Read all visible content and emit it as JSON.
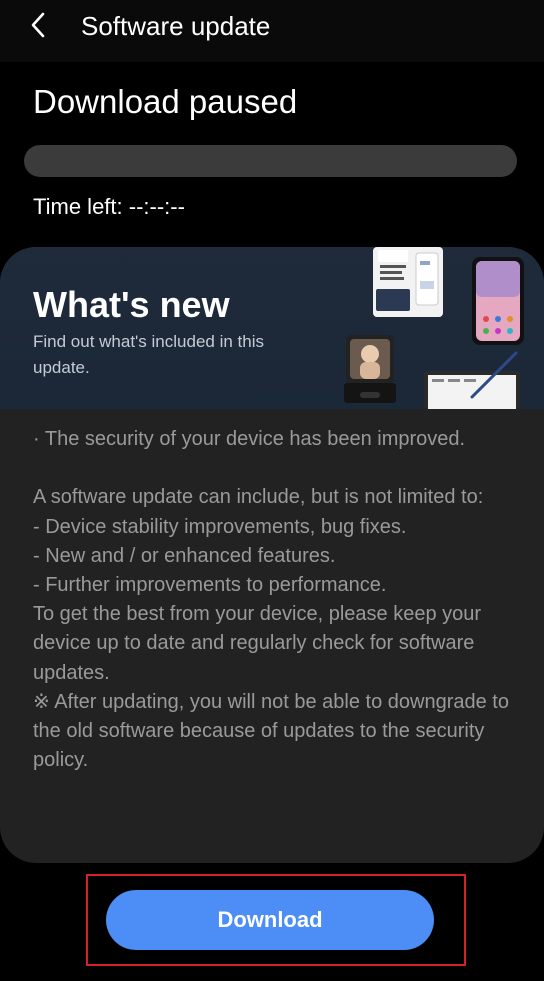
{
  "topbar": {
    "title": "Software update",
    "back_icon": "chevron-left-icon"
  },
  "status": {
    "title": "Download paused",
    "progress": 0,
    "time_left": "Time left: --:--:--"
  },
  "whats_new": {
    "title": "What's new",
    "subtitle": "Find out what's included in this update.",
    "banner_image": "device-collage-image"
  },
  "details": {
    "text": "· The security of your device has been improved.\n\nA software update can include, but is not limited to:\n - Device stability improvements, bug fixes.\n - New and / or enhanced features.\n - Further improvements to performance.\nTo get the best from your device, please keep your device up to date and regularly check for software updates.\n※ After updating, you will not be able to downgrade to the old software because of updates to the security policy."
  },
  "action": {
    "download_label": "Download"
  },
  "colors": {
    "background": "#000000",
    "card": "#222222",
    "banner": "#1f2a3a",
    "button": "#4c8ef5",
    "highlight": "#d81f2a"
  }
}
